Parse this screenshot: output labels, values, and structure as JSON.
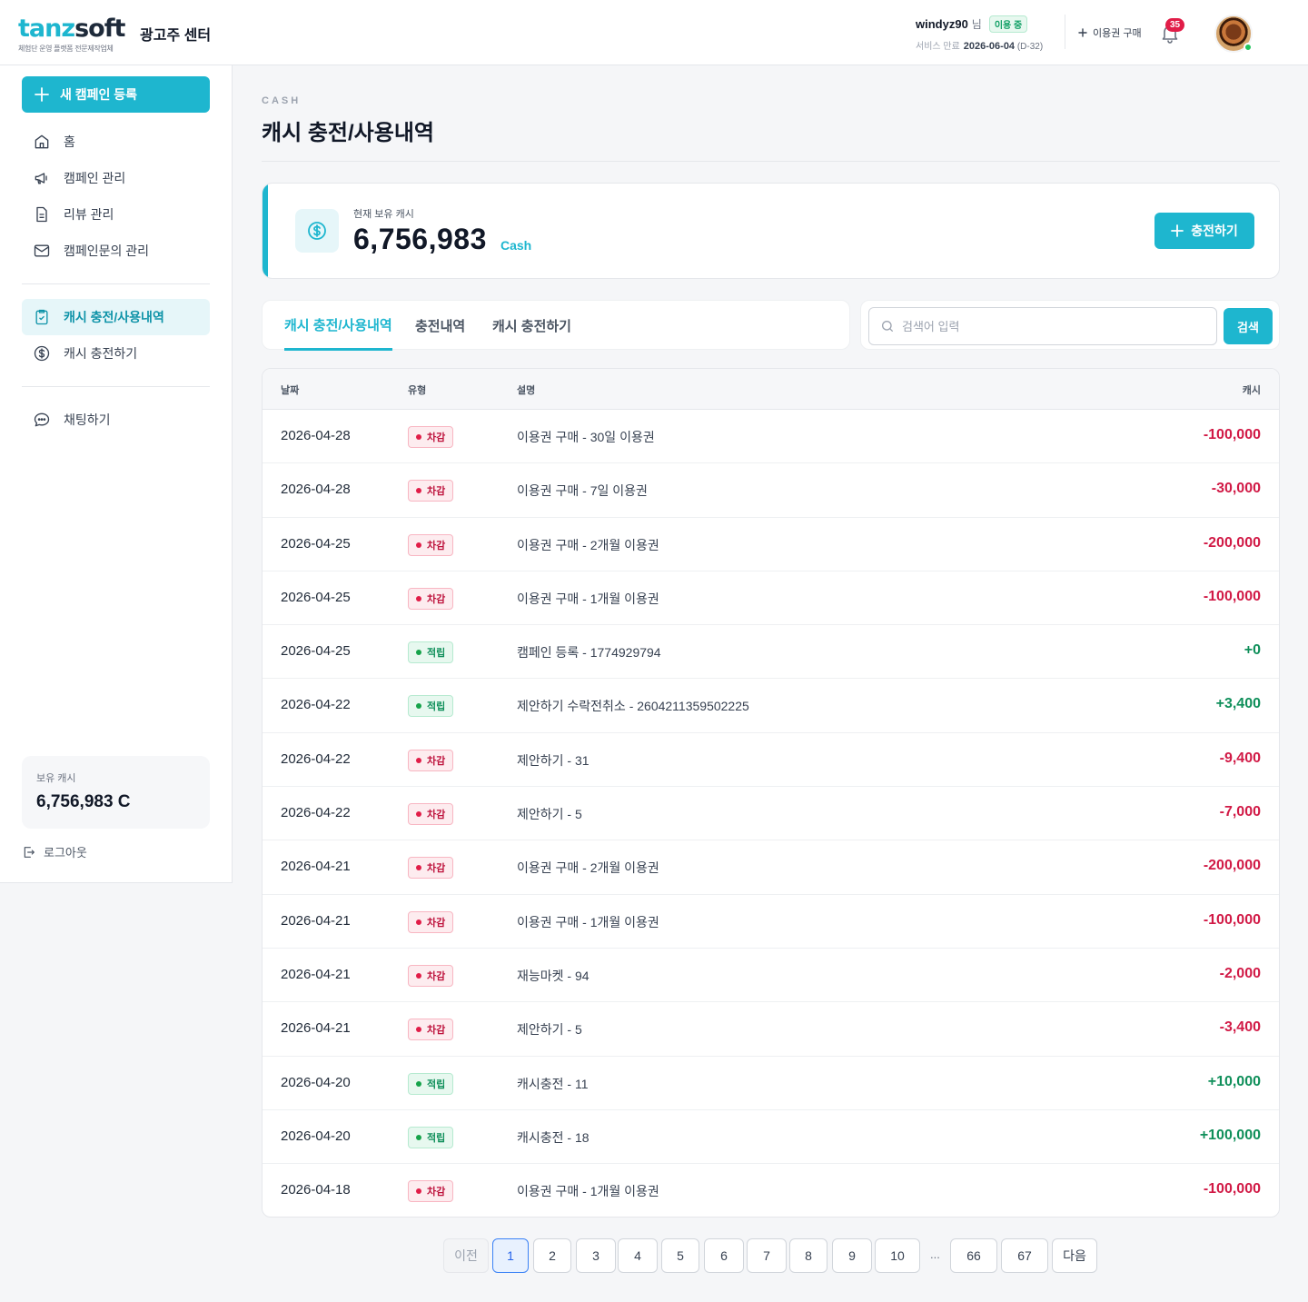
{
  "header": {
    "logo_main_a": "tanz",
    "logo_main_b": "soft",
    "logo_sub": "체험단 운영 플랫폼 전문제작업체",
    "center_name": "광고주 센터",
    "user_id": "windyz90",
    "user_suffix": "님",
    "status_badge": "이용 중",
    "service_label": "서비스 만료",
    "service_date": "2026-06-04",
    "service_dday": "(D-32)",
    "buy_ticket": "이용권 구매",
    "notification_count": "35"
  },
  "sidebar": {
    "new_campaign": "새 캠페인 등록",
    "items": [
      {
        "label": "홈",
        "icon": "home-icon"
      },
      {
        "label": "캠페인 관리",
        "icon": "megaphone-icon"
      },
      {
        "label": "리뷰 관리",
        "icon": "document-icon"
      },
      {
        "label": "캠페인문의 관리",
        "icon": "mail-icon"
      },
      {
        "label": "캐시 충전/사용내역",
        "icon": "clipboard-check-icon"
      },
      {
        "label": "캐시 충전하기",
        "icon": "dollar-icon"
      },
      {
        "label": "채팅하기",
        "icon": "chat-icon"
      }
    ],
    "cash_label": "보유 캐시",
    "cash_value": "6,756,983 C",
    "logout": "로그아웃"
  },
  "page": {
    "kicker": "CASH",
    "title": "캐시 충전/사용내역"
  },
  "balance": {
    "label": "현재 보유 캐시",
    "value": "6,756,983",
    "unit": "Cash",
    "charge_button": "충전하기"
  },
  "tabs": [
    "캐시 충전/사용내역",
    "충전내역",
    "캐시 충전하기"
  ],
  "search": {
    "placeholder": "검색어 입력",
    "value": "",
    "button": "검색"
  },
  "table": {
    "headers": {
      "date": "날짜",
      "type": "유형",
      "desc": "설명",
      "amount": "캐시"
    },
    "rows": [
      {
        "date": "2026-04-28",
        "type": "차감",
        "desc": "이용권 구매 - 30일 이용권",
        "amount": "-100,000"
      },
      {
        "date": "2026-04-28",
        "type": "차감",
        "desc": "이용권 구매 - 7일 이용권",
        "amount": "-30,000"
      },
      {
        "date": "2026-04-25",
        "type": "차감",
        "desc": "이용권 구매 - 2개월 이용권",
        "amount": "-200,000"
      },
      {
        "date": "2026-04-25",
        "type": "차감",
        "desc": "이용권 구매 - 1개월 이용권",
        "amount": "-100,000"
      },
      {
        "date": "2026-04-25",
        "type": "적립",
        "desc": "캠페인 등록 - 1774929794",
        "amount": "+0"
      },
      {
        "date": "2026-04-22",
        "type": "적립",
        "desc": "제안하기 수락전취소 - 2604211359502225",
        "amount": "+3,400"
      },
      {
        "date": "2026-04-22",
        "type": "차감",
        "desc": "제안하기 - 31",
        "amount": "-9,400"
      },
      {
        "date": "2026-04-22",
        "type": "차감",
        "desc": "제안하기 - 5",
        "amount": "-7,000"
      },
      {
        "date": "2026-04-21",
        "type": "차감",
        "desc": "이용권 구매 - 2개월 이용권",
        "amount": "-200,000"
      },
      {
        "date": "2026-04-21",
        "type": "차감",
        "desc": "이용권 구매 - 1개월 이용권",
        "amount": "-100,000"
      },
      {
        "date": "2026-04-21",
        "type": "차감",
        "desc": "재능마켓 - 94",
        "amount": "-2,000"
      },
      {
        "date": "2026-04-21",
        "type": "차감",
        "desc": "제안하기 - 5",
        "amount": "-3,400"
      },
      {
        "date": "2026-04-20",
        "type": "적립",
        "desc": "캐시충전 - 11",
        "amount": "+10,000"
      },
      {
        "date": "2026-04-20",
        "type": "적립",
        "desc": "캐시충전 - 18",
        "amount": "+100,000"
      },
      {
        "date": "2026-04-18",
        "type": "차감",
        "desc": "이용권 구매 - 1개월 이용권",
        "amount": "-100,000"
      }
    ]
  },
  "pagination": {
    "prev": "이전",
    "next": "다음",
    "pages": [
      "1",
      "2",
      "3",
      "4",
      "5",
      "6",
      "7",
      "8",
      "9",
      "10"
    ],
    "ellipsis": "...",
    "tail_pages": [
      "66",
      "67"
    ],
    "current": "1"
  },
  "colors": {
    "accent": "#1eb6cf",
    "deduct": "#d11a46",
    "earn": "#0f8f5a"
  }
}
